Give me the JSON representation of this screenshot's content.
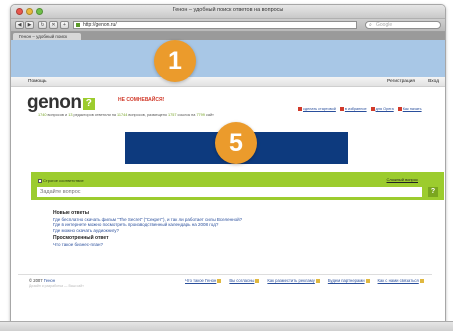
{
  "browser": {
    "window_title": "Генон – удобный поиск ответов на вопросы",
    "url": "http://genon.ru/",
    "search_placeholder": "Google",
    "tab_label": "Генон – удобный поиск"
  },
  "topnav": {
    "help": "Помощь",
    "register": "Регистрация",
    "login": "Вход"
  },
  "logo": {
    "text": "genon",
    "mark": "?",
    "slogan": "НЕ СОМНЕВАЙСЯ!"
  },
  "stats": {
    "n1": "1740",
    "t1": "вопросов и",
    "n2": "13",
    "t2": "редакторов ответили на",
    "n3": "11744",
    "t3": "вопросов, размещено",
    "n4": "1757",
    "t4": "ссылок на",
    "n5": "7799",
    "t5": "сайт"
  },
  "toplinks": [
    {
      "label": "сделать стартовой"
    },
    {
      "label": "в избранное"
    },
    {
      "label": "для Opera"
    },
    {
      "label": "Как начать"
    }
  ],
  "search": {
    "strict_label": "Строгое соответствие",
    "complex_label": "Сложный вопрос",
    "placeholder": "Задайте вопрос",
    "button": "?"
  },
  "sections": {
    "new_title": "Новые ответы",
    "new_items": [
      "Где бесплатно скачать фильм \"The Secret\" (\"Секрет\"), и так ли работает силы Вселенной?",
      "Где в интернете можно посмотреть производственный календарь на 2008 год?",
      "Где можно скачать аудиокнигу?"
    ],
    "viewed_title": "Просмотренный ответ",
    "viewed_items": [
      "Что такое бизнес-план?"
    ]
  },
  "footer": {
    "copyright": "© 2007",
    "brand": "Генон",
    "sub": "Дизайн и разработка — Ваш сайт",
    "links": [
      {
        "label": "Что такое Генон"
      },
      {
        "label": "Вы согласны"
      },
      {
        "label": "Как разместить рекламу"
      },
      {
        "label": "Будем партнерами"
      },
      {
        "label": "Как с нами связаться"
      }
    ]
  },
  "badges": {
    "top": "1",
    "middle": "5"
  },
  "colors": {
    "banner": "#a8c7e6",
    "accent_green": "#9ccc2e",
    "ad_block": "#0d3a7e",
    "badge": "#eb9b2c",
    "link": "#2a4f9c"
  }
}
